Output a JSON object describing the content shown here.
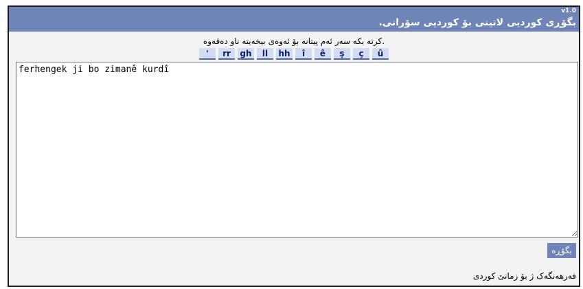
{
  "header": {
    "version": "v1.0",
    "title": "بگۆڕی کوردیی لاتینی بۆ کوردیی سۆرانی."
  },
  "instructions": ".کرته بکه سەر ئەم پیتانه بۆ ئەوەی بیخەیتە ناو دەقەوە",
  "special_chars": [
    "'",
    "rr",
    "gh",
    "ll",
    "hh",
    "î",
    "ê",
    "ş",
    "ç",
    "û"
  ],
  "input": {
    "value": "ferhengek ji bo zimanê kurdî"
  },
  "convert_button": {
    "label": "بگۆڕە"
  },
  "footer": {
    "text": "فەرهەنگەک ژ بۆ زمانێ کوردی"
  },
  "colors": {
    "header_bg": "#6f84b7",
    "char_button_bg": "#d2ddf1",
    "char_button_text": "#0b1f6e"
  }
}
